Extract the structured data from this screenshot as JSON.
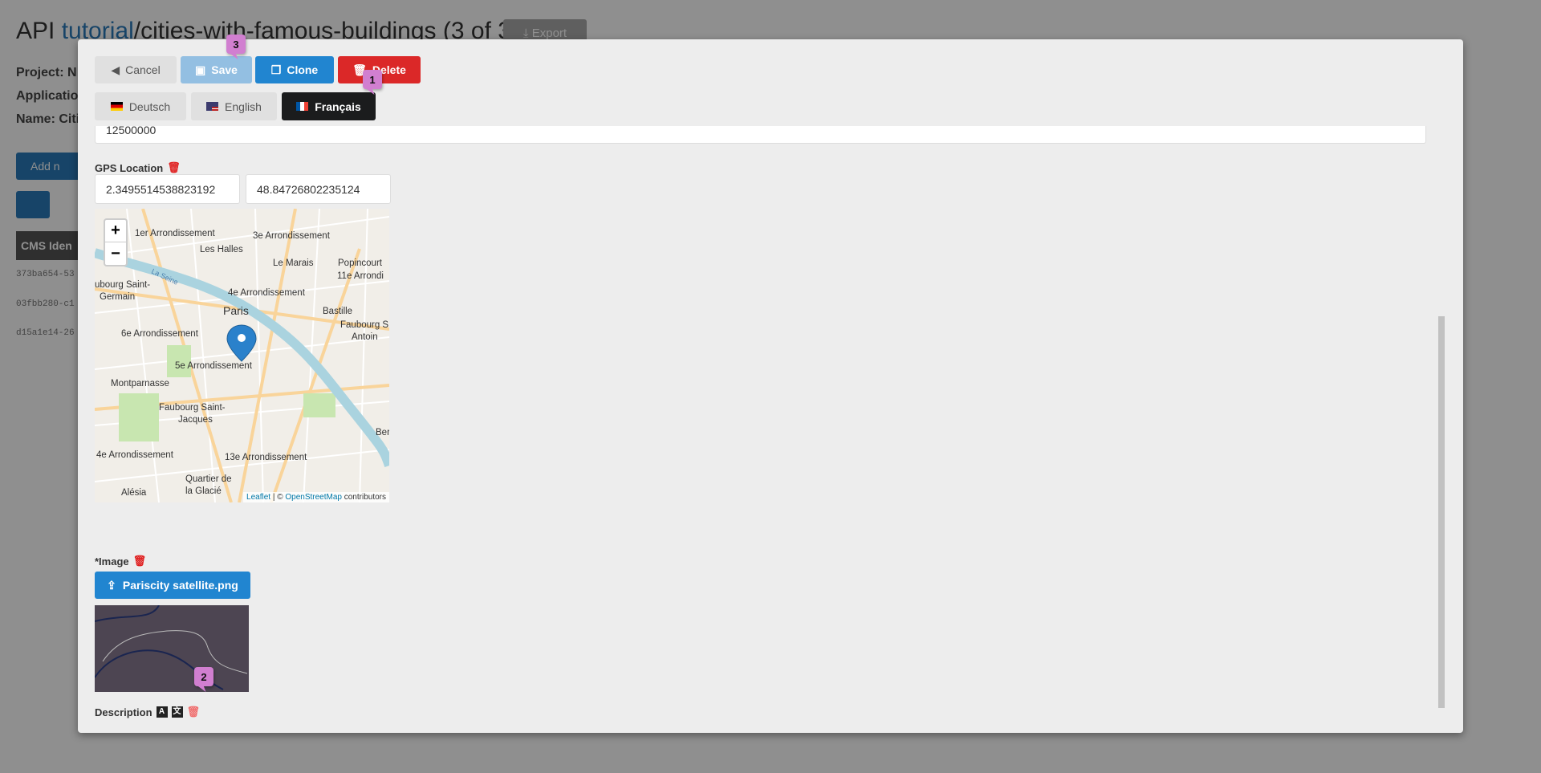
{
  "background": {
    "title_prefix": "API ",
    "title_link": "tutorial",
    "title_rest": "/cities-with-famous-buildings (3 of 3)",
    "export_label": "Export",
    "meta": [
      "Project: N",
      "Applicatio",
      "Name: Citi"
    ],
    "add_label": "Add n",
    "table_header": "CMS Iden",
    "rows": [
      "373ba654-53",
      "03fbb280-c1",
      "d15a1e14-26"
    ]
  },
  "toolbar": {
    "cancel_label": "Cancel",
    "save_label": "Save",
    "clone_label": "Clone",
    "delete_label": "Delete"
  },
  "languages": [
    {
      "label": "Deutsch",
      "active": false
    },
    {
      "label": "English",
      "active": false
    },
    {
      "label": "Français",
      "active": true
    }
  ],
  "badges": [
    "1",
    "2",
    "3"
  ],
  "form": {
    "population_value": "12500000",
    "gps_label": "GPS Location",
    "gps_lng": "2.3495514538823192",
    "gps_lat": "48.84726802235124",
    "map": {
      "zoom_in": "+",
      "zoom_out": "−",
      "labels": [
        "1er Arrondissement",
        "3e Arrondissement",
        "Les Halles",
        "Le Marais",
        "Popincourt",
        "11e Arrondi",
        "ubourg Saint-",
        "Germain",
        "4e Arrondissement",
        "Paris",
        "Bastille",
        "Faubourg S",
        "Antoin",
        "6e Arrondissement",
        "5e Arrondissement",
        "Montparnasse",
        "Faubourg Saint-",
        "Jacques",
        "Ber",
        "4e Arrondissement",
        "13e Arrondissement",
        "Quartier de",
        "la Glacié",
        "Alésia",
        "La Seine"
      ],
      "attribution_leaflet": "Leaflet",
      "attribution_sep": " | © ",
      "attribution_osm": "OpenStreetMap",
      "attribution_suffix": " contributors"
    },
    "image_label": "*Image",
    "image_file": "Pariscity satellite.png",
    "description_label": "Description",
    "description_value": ""
  },
  "colors": {
    "primary": "#2185d0",
    "danger": "#db2828",
    "badge": "#d17fd0"
  }
}
